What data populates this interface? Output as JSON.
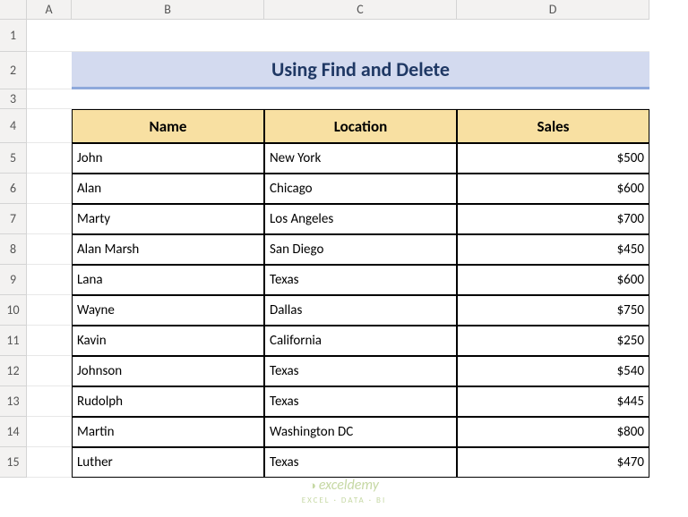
{
  "columns": [
    "",
    "A",
    "B",
    "C",
    "D"
  ],
  "rows": [
    "1",
    "2",
    "3",
    "4",
    "5",
    "6",
    "7",
    "8",
    "9",
    "10",
    "11",
    "12",
    "13",
    "14",
    "15"
  ],
  "title": "Using Find and Delete",
  "headers": {
    "name": "Name",
    "location": "Location",
    "sales": "Sales"
  },
  "data": [
    {
      "name": "John",
      "location": "New York",
      "sales": "$500"
    },
    {
      "name": "Alan",
      "location": "Chicago",
      "sales": "$600"
    },
    {
      "name": "Marty",
      "location": "Los Angeles",
      "sales": "$700"
    },
    {
      "name": "Alan Marsh",
      "location": "San Diego",
      "sales": "$450"
    },
    {
      "name": "Lana",
      "location": "Texas",
      "sales": "$600"
    },
    {
      "name": "Wayne",
      "location": "Dallas",
      "sales": "$750"
    },
    {
      "name": "Kavin",
      "location": "California",
      "sales": "$250"
    },
    {
      "name": "Johnson",
      "location": "Texas",
      "sales": "$540"
    },
    {
      "name": "Rudolph",
      "location": "Texas",
      "sales": "$445"
    },
    {
      "name": "Martin",
      "location": "Washington DC",
      "sales": "$800"
    },
    {
      "name": "Luther",
      "location": "Texas",
      "sales": "$470"
    }
  ],
  "watermark": {
    "brand": "exceldemy",
    "tag": "EXCEL · DATA · BI"
  },
  "chart_data": {
    "type": "table",
    "title": "Using Find and Delete",
    "columns": [
      "Name",
      "Location",
      "Sales"
    ],
    "rows": [
      [
        "John",
        "New York",
        500
      ],
      [
        "Alan",
        "Chicago",
        600
      ],
      [
        "Marty",
        "Los Angeles",
        700
      ],
      [
        "Alan Marsh",
        "San Diego",
        450
      ],
      [
        "Lana",
        "Texas",
        600
      ],
      [
        "Wayne",
        "Dallas",
        750
      ],
      [
        "Kavin",
        "California",
        250
      ],
      [
        "Johnson",
        "Texas",
        540
      ],
      [
        "Rudolph",
        "Texas",
        445
      ],
      [
        "Martin",
        "Washington DC",
        800
      ],
      [
        "Luther",
        "Texas",
        470
      ]
    ]
  }
}
